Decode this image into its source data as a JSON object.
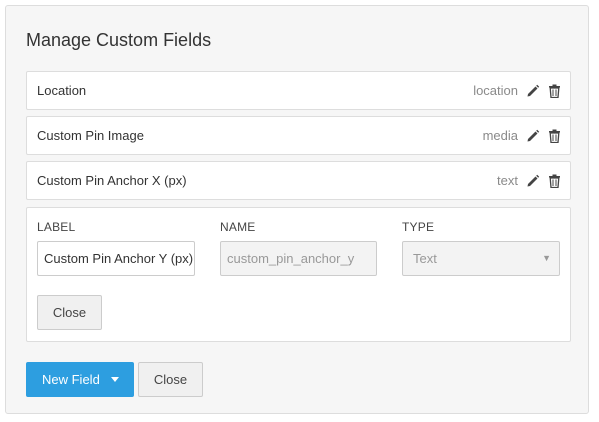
{
  "dialog": {
    "title": "Manage Custom Fields"
  },
  "fields": [
    {
      "label": "Location",
      "type": "location"
    },
    {
      "label": "Custom Pin Image",
      "type": "media"
    },
    {
      "label": "Custom Pin Anchor X (px)",
      "type": "text"
    }
  ],
  "editor": {
    "label_heading": "LABEL",
    "name_heading": "NAME",
    "type_heading": "TYPE",
    "label_value": "Custom Pin Anchor Y (px)",
    "name_value": "custom_pin_anchor_y",
    "type_value": "Text",
    "close_label": "Close"
  },
  "footer": {
    "new_field_label": "New Field",
    "close_label": "Close"
  },
  "icons": {
    "edit": "pencil-icon",
    "delete": "trash-icon",
    "dropdown": "caret-down-icon"
  },
  "colors": {
    "primary": "#2d9ee0",
    "panel_bg": "#f6f6f6"
  }
}
